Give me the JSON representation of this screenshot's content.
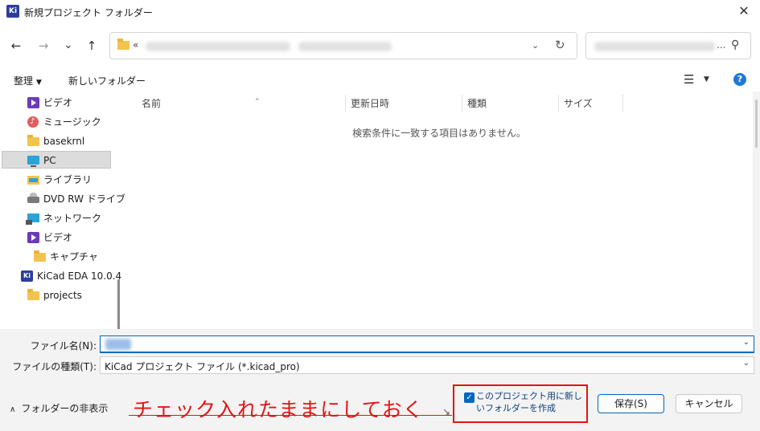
{
  "window": {
    "app_icon": "KiCad",
    "title": "新規プロジェクト フォルダー"
  },
  "nav": {
    "back_icon": "←",
    "forward_icon": "→",
    "recent_icon": "⌄",
    "up_icon": "↑",
    "address_prefix": "«",
    "search_ellipsis": "..."
  },
  "toolbar": {
    "organize_label": "整理",
    "new_folder_label": "新しいフォルダー"
  },
  "sidebar": {
    "items": [
      {
        "label": "ビデオ",
        "icon": "video-icon"
      },
      {
        "label": "ミュージック",
        "icon": "music-icon"
      },
      {
        "label": "basekrnl",
        "icon": "folder-icon"
      },
      {
        "label": "PC",
        "icon": "pc-icon"
      },
      {
        "label": "ライブラリ",
        "icon": "library-icon"
      },
      {
        "label": "DVD RW ドライブ",
        "icon": "dvd-icon"
      },
      {
        "label": "ネットワーク",
        "icon": "network-icon"
      },
      {
        "label": "ビデオ",
        "icon": "video-icon"
      },
      {
        "label": "キャプチャ",
        "icon": "folder-icon"
      },
      {
        "label": "KiCad EDA 10.0.4",
        "icon": "kicad-icon"
      },
      {
        "label": "projects",
        "icon": "folder-icon"
      }
    ]
  },
  "file_list": {
    "columns": [
      "名前",
      "更新日時",
      "種類",
      "サイズ"
    ],
    "empty_message": "検索条件に一致する項目はありません。"
  },
  "form": {
    "filename_label": "ファイル名(N):",
    "filetype_label": "ファイルの種類(T):",
    "filetype_value": "KiCad プロジェクト ファイル (*.kicad_pro)"
  },
  "footer": {
    "hide_folders_label": "フォルダーの非表示",
    "annotation_text": "チェック入れたままにしておく",
    "checkbox_label": "このプロジェクト用に新しいフォルダーを作成",
    "checkbox_checked": true,
    "save_label": "保存(S)",
    "cancel_label": "キャンセル"
  },
  "colors": {
    "accent": "#0067c0",
    "annotation": "#e31414"
  }
}
